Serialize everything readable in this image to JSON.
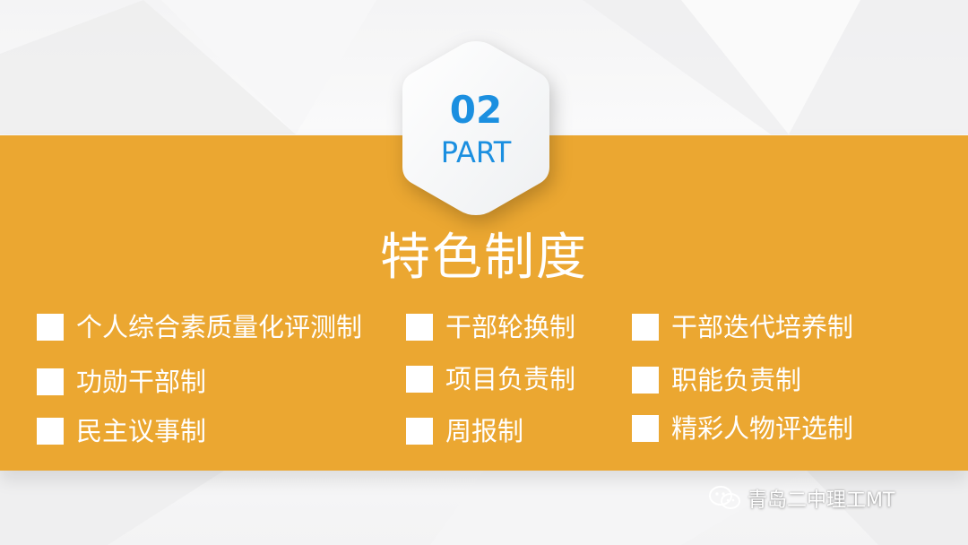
{
  "section": {
    "number": "02",
    "part_label": "PART"
  },
  "title": "特色制度",
  "items": [
    {
      "label": "个人综合素质量化评测制"
    },
    {
      "label": "干部轮换制"
    },
    {
      "label": "干部迭代培养制"
    },
    {
      "label": "功勋干部制"
    },
    {
      "label": "项目负责制"
    },
    {
      "label": "职能负责制"
    },
    {
      "label": "民主议事制"
    },
    {
      "label": "周报制"
    },
    {
      "label": "精彩人物评选制"
    }
  ],
  "watermark": {
    "text": "青岛二中理工MT",
    "icon": "wechat-icon"
  },
  "colors": {
    "band": "#eba731",
    "accent_text": "#1b8fe0",
    "foreground": "#ffffff"
  }
}
